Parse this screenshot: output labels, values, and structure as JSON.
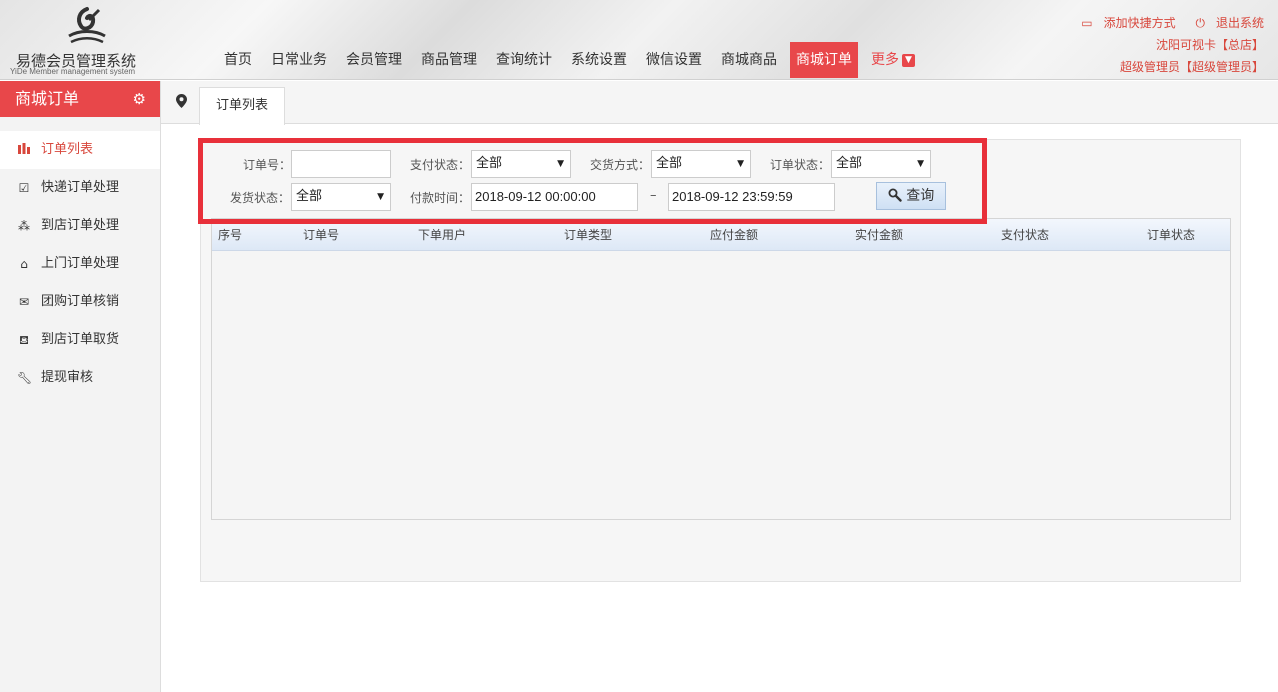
{
  "header": {
    "logo_title": "易德会员管理系统",
    "logo_subtitle": "YiDe Member management system",
    "nav": [
      "首页",
      "日常业务",
      "会员管理",
      "商品管理",
      "查询统计",
      "系统设置",
      "微信设置",
      "商城商品",
      "商城订单"
    ],
    "nav_more": "更多",
    "shortcut": "添加快捷方式",
    "logout": "退出系统",
    "store": "沈阳可视卡【总店】",
    "user": "超级管理员【超级管理员】"
  },
  "sidebar": {
    "title": "商城订单",
    "items": [
      {
        "label": "订单列表",
        "icon": "bar-chart-icon"
      },
      {
        "label": "快递订单处理",
        "icon": "checkbox-icon"
      },
      {
        "label": "到店订单处理",
        "icon": "cubes-icon"
      },
      {
        "label": "上门订单处理",
        "icon": "home-icon"
      },
      {
        "label": "团购订单核销",
        "icon": "envelope-icon"
      },
      {
        "label": "到店订单取货",
        "icon": "basket-icon"
      },
      {
        "label": "提现审核",
        "icon": "wrench-icon"
      }
    ]
  },
  "tabs": [
    "订单列表"
  ],
  "filters": {
    "order_no_label": "订单号：",
    "order_no_value": "",
    "pay_status_label": "支付状态：",
    "pay_status_value": "全部",
    "delivery_label": "交货方式：",
    "delivery_value": "全部",
    "order_status_label": "订单状态：",
    "order_status_value": "全部",
    "ship_status_label": "发货状态：",
    "ship_status_value": "全部",
    "pay_time_label": "付款时间：",
    "pay_time_start": "2018-09-12 00:00:00",
    "pay_time_sep": "–",
    "pay_time_end": "2018-09-12 23:59:59",
    "query_button": "查询"
  },
  "table": {
    "columns": [
      "序号",
      "订单号",
      "下单用户",
      "订单类型",
      "应付金额",
      "实付金额",
      "支付状态",
      "订单状态"
    ],
    "rows": []
  },
  "colors": {
    "accent": "#e8474a",
    "highlight_box": "#e8303a"
  }
}
